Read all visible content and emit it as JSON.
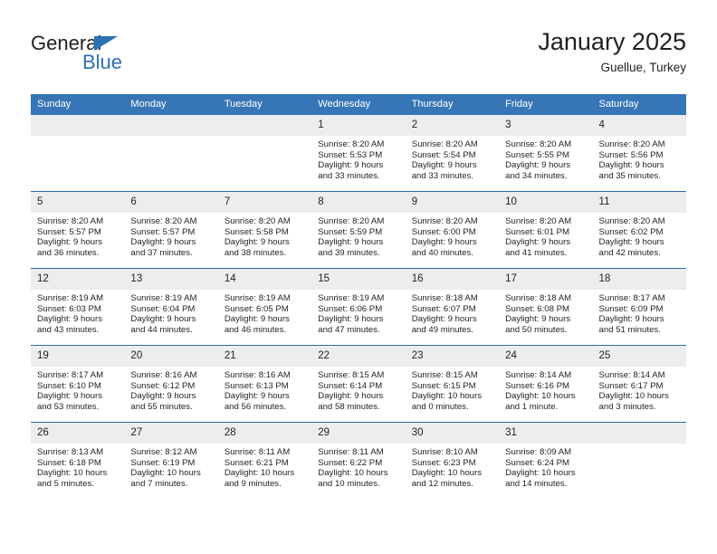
{
  "brand": {
    "name_top": "General",
    "name_bottom": "Blue",
    "accent_color": "#2b72b5"
  },
  "header": {
    "title": "January 2025",
    "subtitle": "Guellue, Turkey"
  },
  "theme": {
    "header_row_bg": "#3676b6",
    "daynum_bg": "#ededed",
    "week_divider": "#2b6cad",
    "text": "#231f20"
  },
  "weekdays": [
    "Sunday",
    "Monday",
    "Tuesday",
    "Wednesday",
    "Thursday",
    "Friday",
    "Saturday"
  ],
  "weeks": [
    [
      {
        "day": "",
        "sunrise": "",
        "sunset": "",
        "daylight_line1": "",
        "daylight_line2": ""
      },
      {
        "day": "",
        "sunrise": "",
        "sunset": "",
        "daylight_line1": "",
        "daylight_line2": ""
      },
      {
        "day": "",
        "sunrise": "",
        "sunset": "",
        "daylight_line1": "",
        "daylight_line2": ""
      },
      {
        "day": "1",
        "sunrise": "Sunrise: 8:20 AM",
        "sunset": "Sunset: 5:53 PM",
        "daylight_line1": "Daylight: 9 hours",
        "daylight_line2": "and 33 minutes."
      },
      {
        "day": "2",
        "sunrise": "Sunrise: 8:20 AM",
        "sunset": "Sunset: 5:54 PM",
        "daylight_line1": "Daylight: 9 hours",
        "daylight_line2": "and 33 minutes."
      },
      {
        "day": "3",
        "sunrise": "Sunrise: 8:20 AM",
        "sunset": "Sunset: 5:55 PM",
        "daylight_line1": "Daylight: 9 hours",
        "daylight_line2": "and 34 minutes."
      },
      {
        "day": "4",
        "sunrise": "Sunrise: 8:20 AM",
        "sunset": "Sunset: 5:56 PM",
        "daylight_line1": "Daylight: 9 hours",
        "daylight_line2": "and 35 minutes."
      }
    ],
    [
      {
        "day": "5",
        "sunrise": "Sunrise: 8:20 AM",
        "sunset": "Sunset: 5:57 PM",
        "daylight_line1": "Daylight: 9 hours",
        "daylight_line2": "and 36 minutes."
      },
      {
        "day": "6",
        "sunrise": "Sunrise: 8:20 AM",
        "sunset": "Sunset: 5:57 PM",
        "daylight_line1": "Daylight: 9 hours",
        "daylight_line2": "and 37 minutes."
      },
      {
        "day": "7",
        "sunrise": "Sunrise: 8:20 AM",
        "sunset": "Sunset: 5:58 PM",
        "daylight_line1": "Daylight: 9 hours",
        "daylight_line2": "and 38 minutes."
      },
      {
        "day": "8",
        "sunrise": "Sunrise: 8:20 AM",
        "sunset": "Sunset: 5:59 PM",
        "daylight_line1": "Daylight: 9 hours",
        "daylight_line2": "and 39 minutes."
      },
      {
        "day": "9",
        "sunrise": "Sunrise: 8:20 AM",
        "sunset": "Sunset: 6:00 PM",
        "daylight_line1": "Daylight: 9 hours",
        "daylight_line2": "and 40 minutes."
      },
      {
        "day": "10",
        "sunrise": "Sunrise: 8:20 AM",
        "sunset": "Sunset: 6:01 PM",
        "daylight_line1": "Daylight: 9 hours",
        "daylight_line2": "and 41 minutes."
      },
      {
        "day": "11",
        "sunrise": "Sunrise: 8:20 AM",
        "sunset": "Sunset: 6:02 PM",
        "daylight_line1": "Daylight: 9 hours",
        "daylight_line2": "and 42 minutes."
      }
    ],
    [
      {
        "day": "12",
        "sunrise": "Sunrise: 8:19 AM",
        "sunset": "Sunset: 6:03 PM",
        "daylight_line1": "Daylight: 9 hours",
        "daylight_line2": "and 43 minutes."
      },
      {
        "day": "13",
        "sunrise": "Sunrise: 8:19 AM",
        "sunset": "Sunset: 6:04 PM",
        "daylight_line1": "Daylight: 9 hours",
        "daylight_line2": "and 44 minutes."
      },
      {
        "day": "14",
        "sunrise": "Sunrise: 8:19 AM",
        "sunset": "Sunset: 6:05 PM",
        "daylight_line1": "Daylight: 9 hours",
        "daylight_line2": "and 46 minutes."
      },
      {
        "day": "15",
        "sunrise": "Sunrise: 8:19 AM",
        "sunset": "Sunset: 6:06 PM",
        "daylight_line1": "Daylight: 9 hours",
        "daylight_line2": "and 47 minutes."
      },
      {
        "day": "16",
        "sunrise": "Sunrise: 8:18 AM",
        "sunset": "Sunset: 6:07 PM",
        "daylight_line1": "Daylight: 9 hours",
        "daylight_line2": "and 49 minutes."
      },
      {
        "day": "17",
        "sunrise": "Sunrise: 8:18 AM",
        "sunset": "Sunset: 6:08 PM",
        "daylight_line1": "Daylight: 9 hours",
        "daylight_line2": "and 50 minutes."
      },
      {
        "day": "18",
        "sunrise": "Sunrise: 8:17 AM",
        "sunset": "Sunset: 6:09 PM",
        "daylight_line1": "Daylight: 9 hours",
        "daylight_line2": "and 51 minutes."
      }
    ],
    [
      {
        "day": "19",
        "sunrise": "Sunrise: 8:17 AM",
        "sunset": "Sunset: 6:10 PM",
        "daylight_line1": "Daylight: 9 hours",
        "daylight_line2": "and 53 minutes."
      },
      {
        "day": "20",
        "sunrise": "Sunrise: 8:16 AM",
        "sunset": "Sunset: 6:12 PM",
        "daylight_line1": "Daylight: 9 hours",
        "daylight_line2": "and 55 minutes."
      },
      {
        "day": "21",
        "sunrise": "Sunrise: 8:16 AM",
        "sunset": "Sunset: 6:13 PM",
        "daylight_line1": "Daylight: 9 hours",
        "daylight_line2": "and 56 minutes."
      },
      {
        "day": "22",
        "sunrise": "Sunrise: 8:15 AM",
        "sunset": "Sunset: 6:14 PM",
        "daylight_line1": "Daylight: 9 hours",
        "daylight_line2": "and 58 minutes."
      },
      {
        "day": "23",
        "sunrise": "Sunrise: 8:15 AM",
        "sunset": "Sunset: 6:15 PM",
        "daylight_line1": "Daylight: 10 hours",
        "daylight_line2": "and 0 minutes."
      },
      {
        "day": "24",
        "sunrise": "Sunrise: 8:14 AM",
        "sunset": "Sunset: 6:16 PM",
        "daylight_line1": "Daylight: 10 hours",
        "daylight_line2": "and 1 minute."
      },
      {
        "day": "25",
        "sunrise": "Sunrise: 8:14 AM",
        "sunset": "Sunset: 6:17 PM",
        "daylight_line1": "Daylight: 10 hours",
        "daylight_line2": "and 3 minutes."
      }
    ],
    [
      {
        "day": "26",
        "sunrise": "Sunrise: 8:13 AM",
        "sunset": "Sunset: 6:18 PM",
        "daylight_line1": "Daylight: 10 hours",
        "daylight_line2": "and 5 minutes."
      },
      {
        "day": "27",
        "sunrise": "Sunrise: 8:12 AM",
        "sunset": "Sunset: 6:19 PM",
        "daylight_line1": "Daylight: 10 hours",
        "daylight_line2": "and 7 minutes."
      },
      {
        "day": "28",
        "sunrise": "Sunrise: 8:11 AM",
        "sunset": "Sunset: 6:21 PM",
        "daylight_line1": "Daylight: 10 hours",
        "daylight_line2": "and 9 minutes."
      },
      {
        "day": "29",
        "sunrise": "Sunrise: 8:11 AM",
        "sunset": "Sunset: 6:22 PM",
        "daylight_line1": "Daylight: 10 hours",
        "daylight_line2": "and 10 minutes."
      },
      {
        "day": "30",
        "sunrise": "Sunrise: 8:10 AM",
        "sunset": "Sunset: 6:23 PM",
        "daylight_line1": "Daylight: 10 hours",
        "daylight_line2": "and 12 minutes."
      },
      {
        "day": "31",
        "sunrise": "Sunrise: 8:09 AM",
        "sunset": "Sunset: 6:24 PM",
        "daylight_line1": "Daylight: 10 hours",
        "daylight_line2": "and 14 minutes."
      },
      {
        "day": "",
        "sunrise": "",
        "sunset": "",
        "daylight_line1": "",
        "daylight_line2": ""
      }
    ]
  ]
}
